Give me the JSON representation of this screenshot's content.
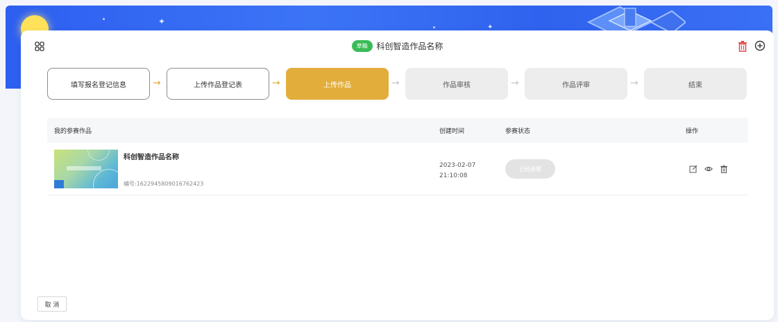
{
  "header": {
    "badge": "草稿",
    "title": "科创智造作品名称"
  },
  "steps": [
    {
      "label": "填写报名登记信息",
      "state": "done"
    },
    {
      "label": "上传作品登记表",
      "state": "done"
    },
    {
      "label": "上传作品",
      "state": "active"
    },
    {
      "label": "作品审核",
      "state": "todo"
    },
    {
      "label": "作品评审",
      "state": "todo"
    },
    {
      "label": "结束",
      "state": "todo"
    }
  ],
  "table": {
    "columns": [
      "我的参赛作品",
      "创建时间",
      "参赛状态",
      "操作"
    ],
    "rows": [
      {
        "title": "科创智造作品名称",
        "id_text": "编号:1622945809016762423",
        "created_date": "2023-02-07",
        "created_time": "21:10:08",
        "status": "已经参赛"
      }
    ]
  },
  "footer": {
    "cancel_label": "取 消"
  },
  "colors": {
    "accent": "#e2ad3b",
    "badge": "#3bbb58",
    "delete": "#e04848",
    "banner": "#2f62ee"
  },
  "icons": {
    "apps": "grid-icon",
    "delete": "trash-icon",
    "add": "plus-circle-icon",
    "edit": "edit-icon",
    "view": "eye-icon"
  }
}
